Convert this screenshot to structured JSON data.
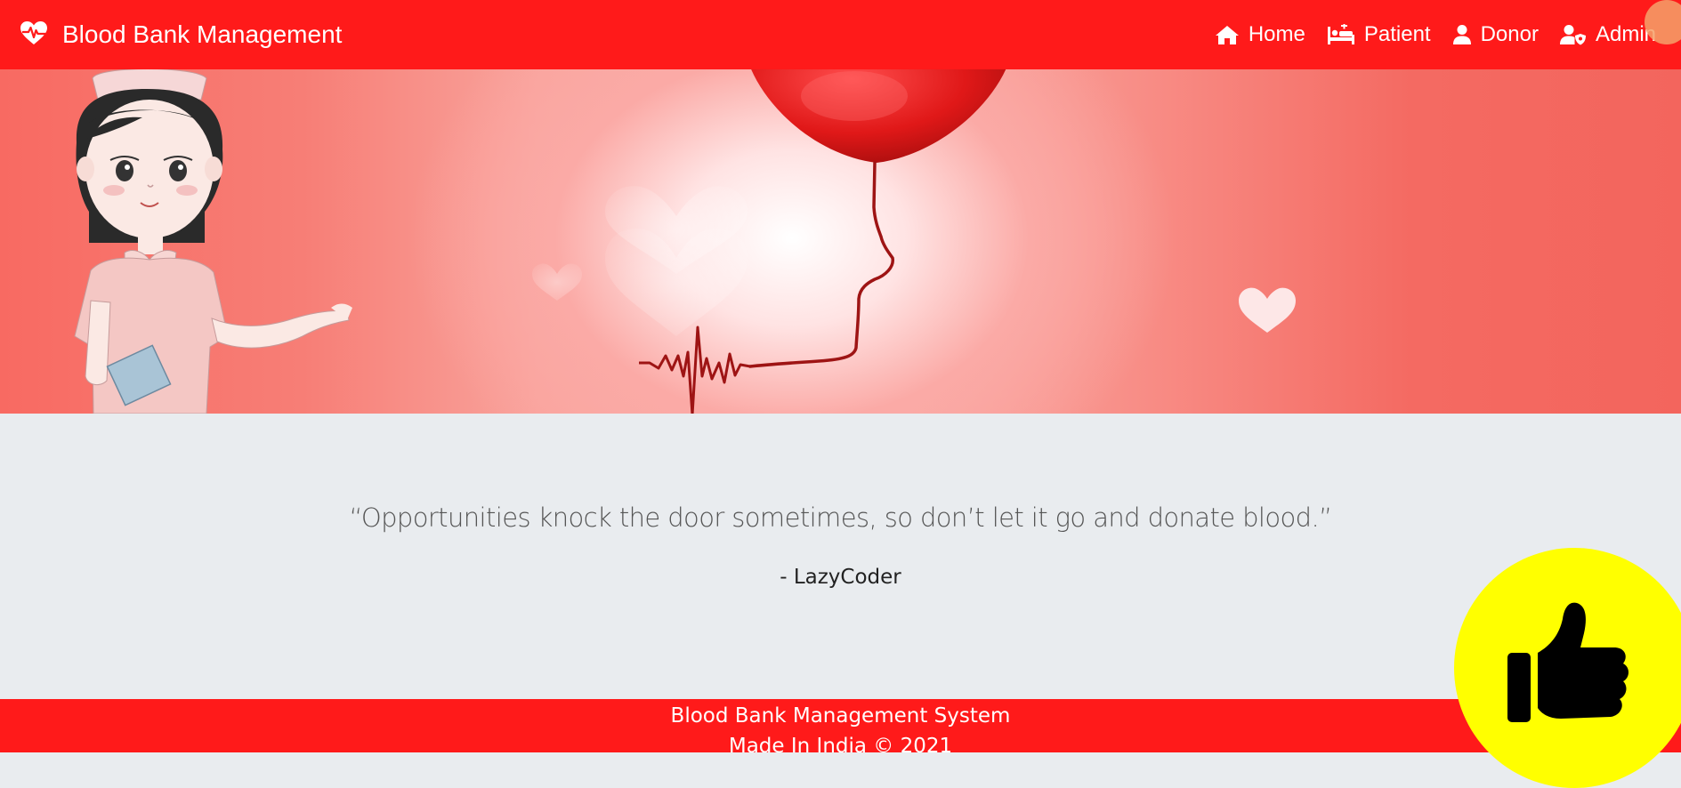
{
  "navbar": {
    "brand_icon": "heartbeat-icon",
    "brand_title": "Blood Bank Management",
    "links": [
      {
        "label": "Home",
        "icon": "home-icon"
      },
      {
        "label": "Patient",
        "icon": "hospital-bed-icon"
      },
      {
        "label": "Donor",
        "icon": "user-icon"
      },
      {
        "label": "Admin",
        "icon": "user-shield-icon"
      }
    ]
  },
  "quote": {
    "text": "“Opportunities knock the door sometimes, so don’t let it go and donate blood.”",
    "author": "- LazyCoder"
  },
  "footer": {
    "line1": "Blood Bank Management System",
    "line2": "Made In India © 2021"
  },
  "overlay": {
    "icon": "thumbs-up-icon",
    "color": "#ffff00"
  },
  "colors": {
    "primary": "#ff1a1a",
    "background": "#e9ecef"
  }
}
